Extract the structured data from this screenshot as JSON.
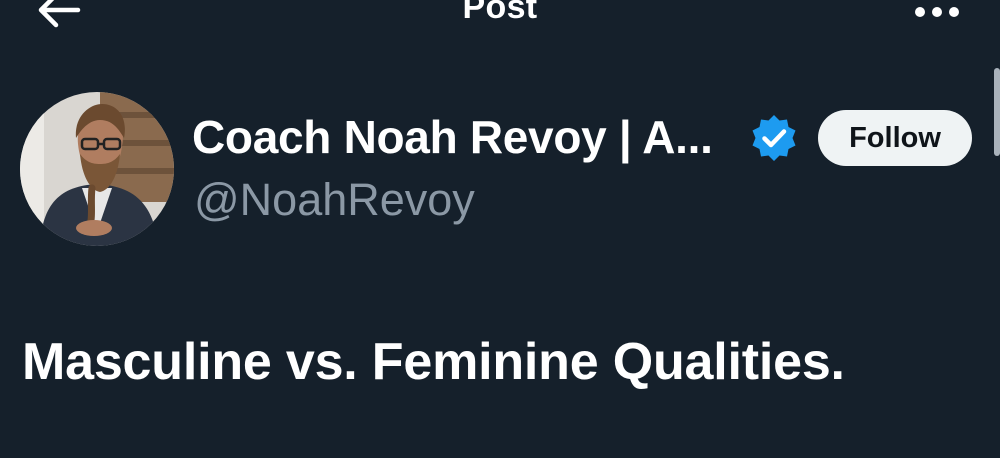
{
  "header": {
    "title": "Post",
    "back_icon": "arrow-left-icon",
    "more_icon": "more-horizontal-icon"
  },
  "author": {
    "display_name": "Coach Noah Revoy | A...",
    "handle": "@NoahRevoy",
    "verified": true,
    "verified_color": "#1d9bf0",
    "avatar_icon": "profile-photo"
  },
  "actions": {
    "follow_label": "Follow"
  },
  "post": {
    "text": "Masculine vs. Feminine Qualities."
  },
  "colors": {
    "background": "#15202b",
    "text_primary": "#ffffff",
    "text_secondary": "#8b98a5",
    "follow_bg": "#eff3f4"
  }
}
